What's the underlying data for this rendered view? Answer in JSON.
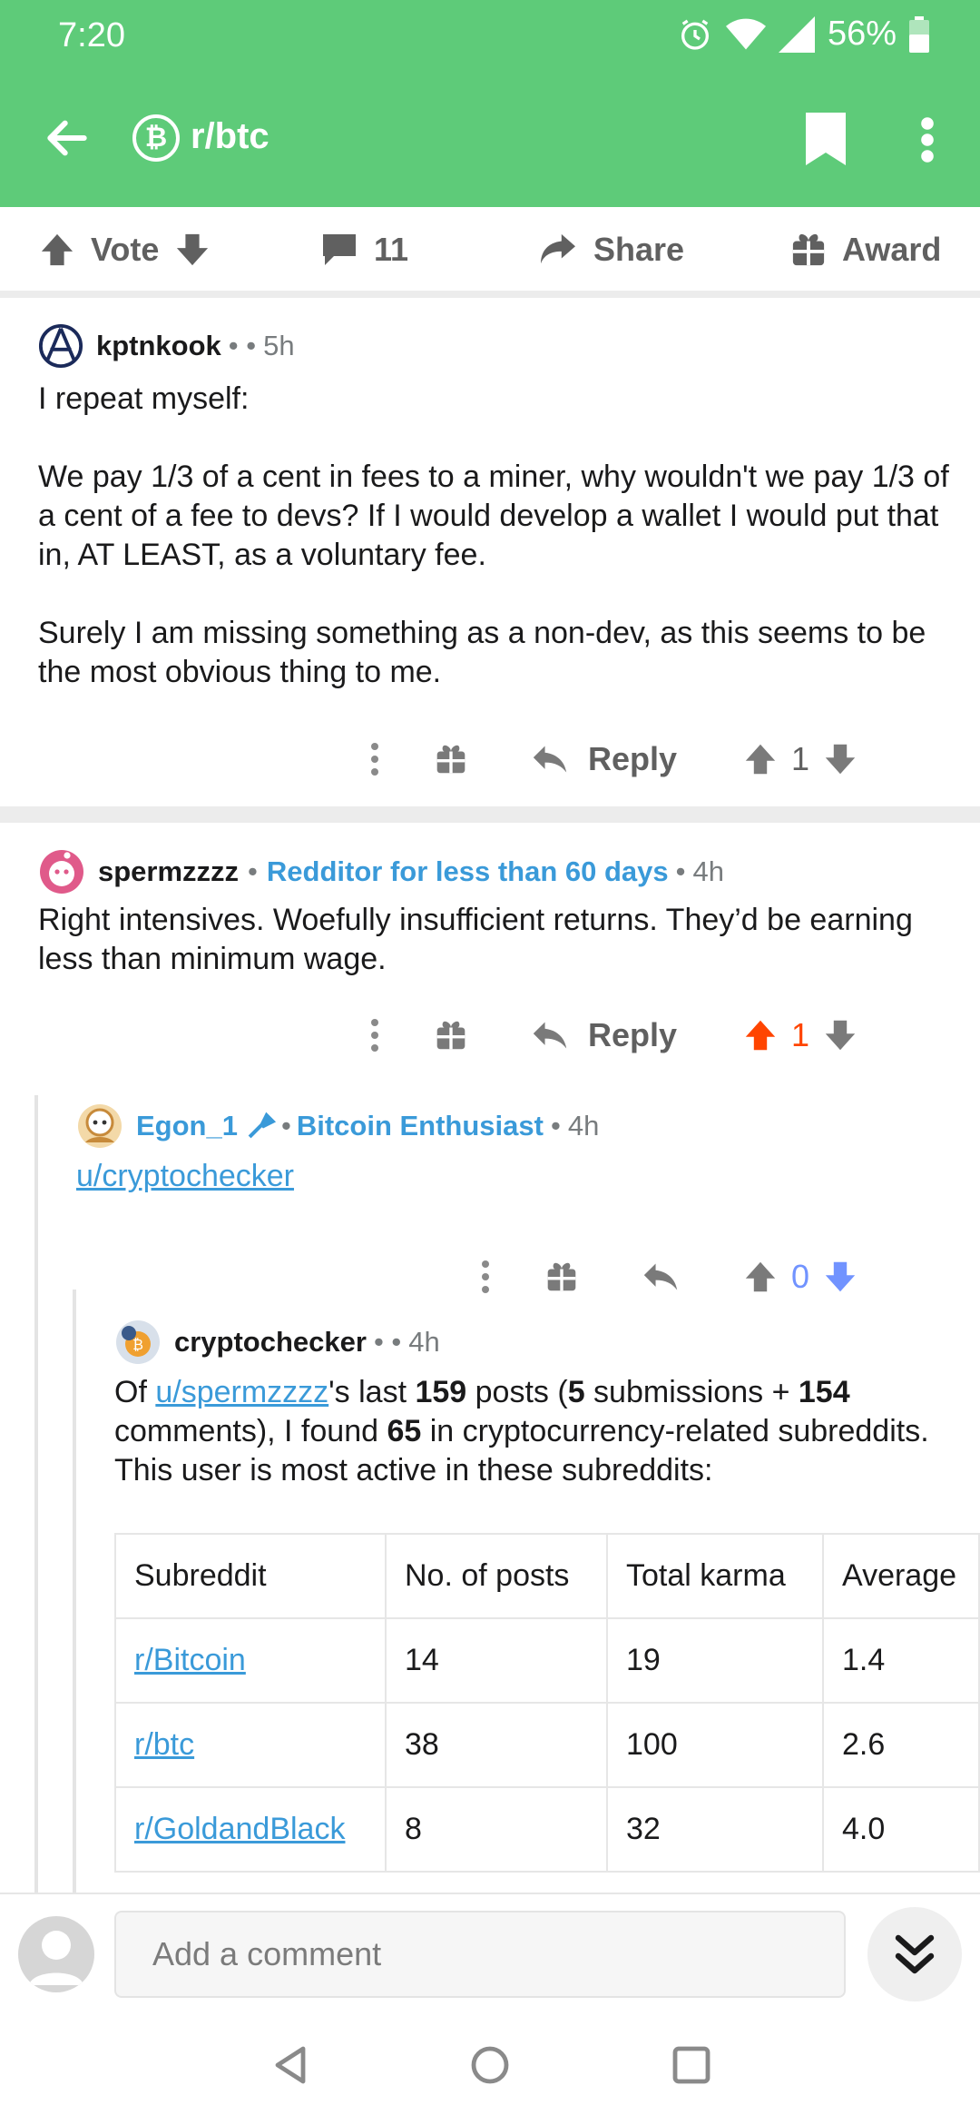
{
  "status_bar": {
    "time": "7:20",
    "battery": "56%"
  },
  "header": {
    "subreddit": "r/btc",
    "subreddit_icon_letter": "₿"
  },
  "post_actions": {
    "vote": "Vote",
    "comments": "11",
    "share": "Share",
    "award": "Award"
  },
  "comments": [
    {
      "user": "kptnkook",
      "time": "5h",
      "paragraphs": [
        "I repeat myself:",
        "We pay 1/3 of a cent in fees to a miner, why wouldn't we pay 1/3 of a cent of a fee to devs? If I would develop a wallet I would put that in, AT LEAST, as a voluntary fee.",
        "Surely I am missing something as a non-dev, as this seems to be the most obvious thing to me."
      ],
      "reply": "Reply",
      "score": "1"
    },
    {
      "user": "spermzzzz",
      "flair": "Redditor for less than 60 days",
      "time": "4h",
      "text": "Right intensives. Woefully insufficient returns. They’d be earning less than minimum wage.",
      "reply": "Reply",
      "score": "1"
    },
    {
      "user": "Egon_1",
      "flair": "Bitcoin Enthusiast",
      "time": "4h",
      "text": "u/cryptochecker",
      "score": "0"
    },
    {
      "user": "cryptochecker",
      "time": "4h",
      "text_parts": {
        "p1": "Of ",
        "user_link": "u/spermzzzz",
        "p2": "'s last ",
        "n1": "159",
        "p3": " posts (",
        "n2": "5",
        "p4": " submissions + ",
        "n3": "154",
        "p5": " comments), I found ",
        "n4": "65",
        "p6": " in cryptocurrency-related subreddits. This user is most active in these subreddits:"
      },
      "table": {
        "headers": [
          "Subreddit",
          "No. of posts",
          "Total karma",
          "Average"
        ],
        "rows": [
          [
            "r/Bitcoin",
            "14",
            "19",
            "1.4"
          ],
          [
            "r/btc",
            "38",
            "100",
            "2.6"
          ],
          [
            "r/GoldandBlack",
            "8",
            "32",
            "4.0"
          ]
        ]
      }
    }
  ],
  "composer": {
    "placeholder": "Add a comment"
  },
  "colors": {
    "header": "#5ecb79",
    "link": "#3a9ad9",
    "upvote_active": "#ff4500",
    "downvote_active": "#7193ff"
  },
  "icons": [
    "back-arrow-icon",
    "bitcoin-icon",
    "bookmark-icon",
    "more-vertical-icon",
    "upvote-icon",
    "downvote-icon",
    "comment-icon",
    "share-icon",
    "gift-icon",
    "reply-icon",
    "double-chevron-down-icon"
  ]
}
